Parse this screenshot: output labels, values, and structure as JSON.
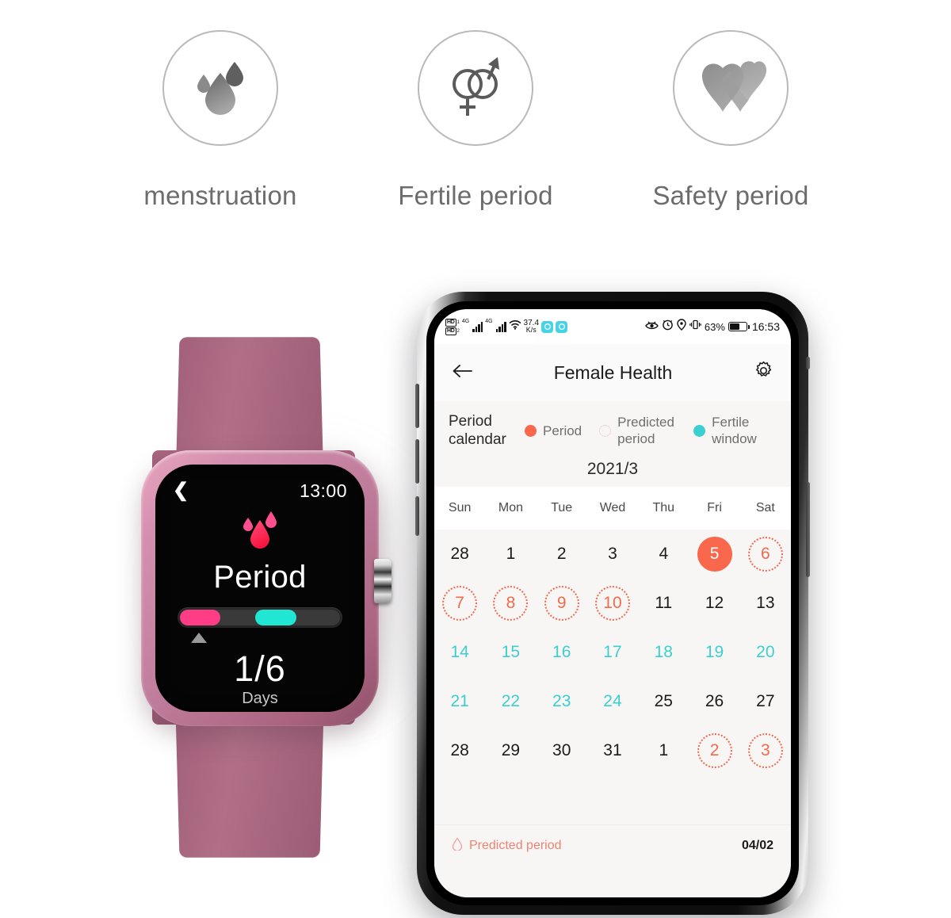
{
  "features": [
    {
      "icon": "blood-drops-icon",
      "label": "menstruation"
    },
    {
      "icon": "male-female-symbols-icon",
      "label": "Fertile period"
    },
    {
      "icon": "two-hearts-icon",
      "label": "Safety period"
    }
  ],
  "watch": {
    "time": "13:00",
    "back_icon": "chevron-left-icon",
    "drops_icon": "blood-drops-icon",
    "title": "Period",
    "progress": {
      "pink_start_pct": 0,
      "pink_width_pct": 25,
      "cyan_start_pct": 47,
      "cyan_width_pct": 26,
      "marker_pct": 13,
      "pink_color": "#ff3d86",
      "cyan_color": "#21e6d4"
    },
    "days_value": "1/6",
    "days_label": "Days"
  },
  "phone": {
    "statusbar": {
      "hd_badge_1": "HD",
      "hd_sub_1": "1",
      "hd_badge_2": "HD",
      "hd_sub_2": "2",
      "net_1": "4G",
      "net_2": "4G",
      "wifi_icon": "wifi-icon",
      "speed_value": "37.4",
      "speed_unit": "K/s",
      "chip_1_icon": "sync-icon",
      "chip_2_icon": "sync-icon",
      "eye_icon": "eye-care-icon",
      "alarm_icon": "alarm-clock-icon",
      "location_icon": "location-pin-icon",
      "vibrate_icon": "vibrate-icon",
      "battery_percent": "63%",
      "battery_level": 62,
      "clock": "16:53"
    },
    "header": {
      "back_icon": "back-arrow-icon",
      "title": "Female Health",
      "settings_icon": "gear-icon"
    },
    "legend": {
      "title": "Period calendar",
      "items": [
        {
          "label": "Period",
          "marker": "filled",
          "color": "#f9674c"
        },
        {
          "label": "Predicted period",
          "marker": "dotted",
          "color": "#e3b9b1"
        },
        {
          "label": "Fertile window",
          "marker": "filled",
          "color": "#3ccfd0"
        }
      ]
    },
    "calendar": {
      "month": "2021/3",
      "weekdays": [
        "Sun",
        "Mon",
        "Tue",
        "Wed",
        "Thu",
        "Fri",
        "Sat"
      ],
      "days": [
        {
          "n": "28",
          "style": "other"
        },
        {
          "n": "1",
          "style": "normal"
        },
        {
          "n": "2",
          "style": "normal"
        },
        {
          "n": "3",
          "style": "normal"
        },
        {
          "n": "4",
          "style": "normal"
        },
        {
          "n": "5",
          "style": "period"
        },
        {
          "n": "6",
          "style": "pred"
        },
        {
          "n": "7",
          "style": "pred"
        },
        {
          "n": "8",
          "style": "pred"
        },
        {
          "n": "9",
          "style": "pred"
        },
        {
          "n": "10",
          "style": "pred"
        },
        {
          "n": "11",
          "style": "normal"
        },
        {
          "n": "12",
          "style": "normal"
        },
        {
          "n": "13",
          "style": "normal"
        },
        {
          "n": "14",
          "style": "cyan"
        },
        {
          "n": "15",
          "style": "cyan"
        },
        {
          "n": "16",
          "style": "cyan"
        },
        {
          "n": "17",
          "style": "cyan"
        },
        {
          "n": "18",
          "style": "cyan"
        },
        {
          "n": "19",
          "style": "cyan"
        },
        {
          "n": "20",
          "style": "cyan"
        },
        {
          "n": "21",
          "style": "cyan"
        },
        {
          "n": "22",
          "style": "cyan"
        },
        {
          "n": "23",
          "style": "cyan"
        },
        {
          "n": "24",
          "style": "cyan"
        },
        {
          "n": "25",
          "style": "normal"
        },
        {
          "n": "26",
          "style": "normal"
        },
        {
          "n": "27",
          "style": "normal"
        },
        {
          "n": "28",
          "style": "normal"
        },
        {
          "n": "29",
          "style": "normal"
        },
        {
          "n": "30",
          "style": "normal"
        },
        {
          "n": "31",
          "style": "normal"
        },
        {
          "n": "1",
          "style": "other"
        },
        {
          "n": "2",
          "style": "pred"
        },
        {
          "n": "3",
          "style": "pred"
        }
      ]
    },
    "footer": {
      "icon": "droplet-outline-icon",
      "label": "Predicted period",
      "date": "04/02"
    }
  }
}
